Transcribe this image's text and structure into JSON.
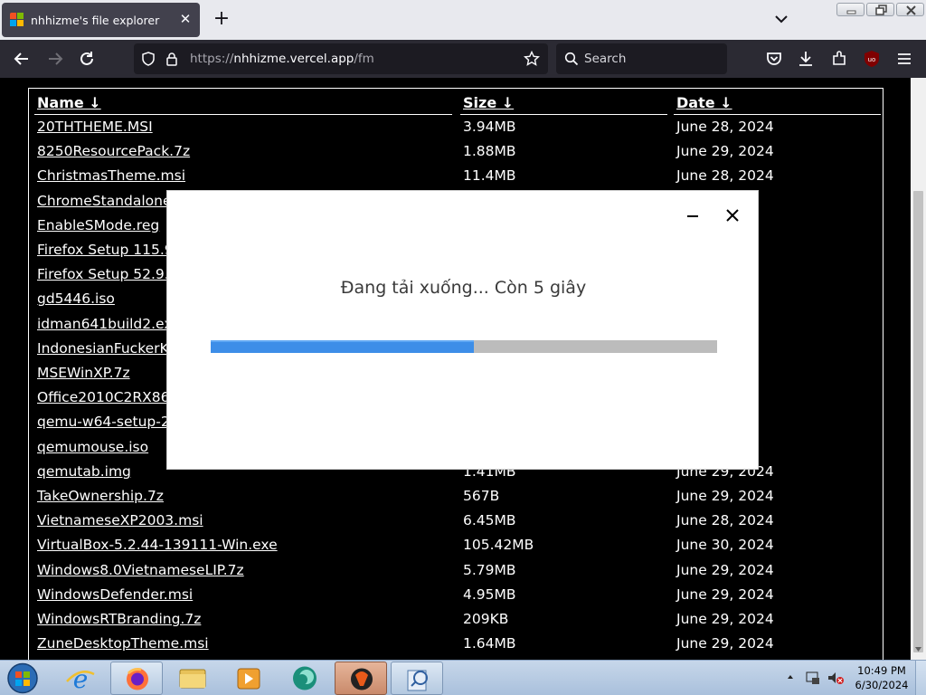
{
  "browser": {
    "tab_title": "nhhizme's file explorer",
    "url_prefix": "https://",
    "url_host": "nhhizme.vercel.app",
    "url_path": "/fm",
    "search_placeholder": "Search",
    "theme_color": "#2b2a33"
  },
  "table": {
    "headers": {
      "name": "Name ↓",
      "size": "Size ↓",
      "date": "Date ↓"
    },
    "rows": [
      {
        "name": "20THTHEME.MSI",
        "size": "3.94MB",
        "date": "June 28, 2024"
      },
      {
        "name": "8250ResourcePack.7z",
        "size": "1.88MB",
        "date": "June 29, 2024"
      },
      {
        "name": "ChristmasTheme.msi",
        "size": "11.4MB",
        "date": "June 28, 2024"
      },
      {
        "name": "ChromeStandalone",
        "size": "",
        "date": "4"
      },
      {
        "name": "EnableSMode.reg",
        "size": "",
        "date": "4"
      },
      {
        "name": "Firefox Setup 115.9",
        "size": "",
        "date": "4"
      },
      {
        "name": "Firefox Setup 52.9.0",
        "size": "",
        "date": "4"
      },
      {
        "name": "gd5446.iso",
        "size": "",
        "date": "4"
      },
      {
        "name": "idman641build2.ex",
        "size": "",
        "date": "4"
      },
      {
        "name": "IndonesianFuckerK",
        "size": "",
        "date": "4"
      },
      {
        "name": "MSEWinXP.7z",
        "size": "",
        "date": "4"
      },
      {
        "name": "Office2010C2RX86F",
        "size": "",
        "date": "4"
      },
      {
        "name": "qemu-w64-setup-20",
        "size": "",
        "date": "4"
      },
      {
        "name": "qemumouse.iso",
        "size": "",
        "date": "4"
      },
      {
        "name": "qemutab.img",
        "size": "1.41MB",
        "date": "June 29, 2024"
      },
      {
        "name": "TakeOwnership.7z",
        "size": "567B",
        "date": "June 29, 2024"
      },
      {
        "name": "VietnameseXP2003.msi",
        "size": "6.45MB",
        "date": "June 28, 2024"
      },
      {
        "name": "VirtualBox-5.2.44-139111-Win.exe",
        "size": "105.42MB",
        "date": "June 30, 2024"
      },
      {
        "name": "Windows8.0VietnameseLIP.7z",
        "size": "5.79MB",
        "date": "June 29, 2024"
      },
      {
        "name": "WindowsDefender.msi",
        "size": "4.95MB",
        "date": "June 29, 2024"
      },
      {
        "name": "WindowsRTBranding.7z",
        "size": "209KB",
        "date": "June 29, 2024"
      },
      {
        "name": "ZuneDesktopTheme.msi",
        "size": "1.64MB",
        "date": "June 29, 2024"
      }
    ]
  },
  "dialog": {
    "message": "Đang tải xuống... Còn 5 giây",
    "progress_fraction": 0.52,
    "progress_color": "#3d8ee8"
  },
  "taskbar": {
    "apps": [
      "start-orb",
      "internet-explorer",
      "firefox",
      "file-explorer",
      "media-player",
      "app-green-circle",
      "app-active",
      "app-system"
    ],
    "time": "10:49 PM",
    "date": "6/30/2024"
  }
}
